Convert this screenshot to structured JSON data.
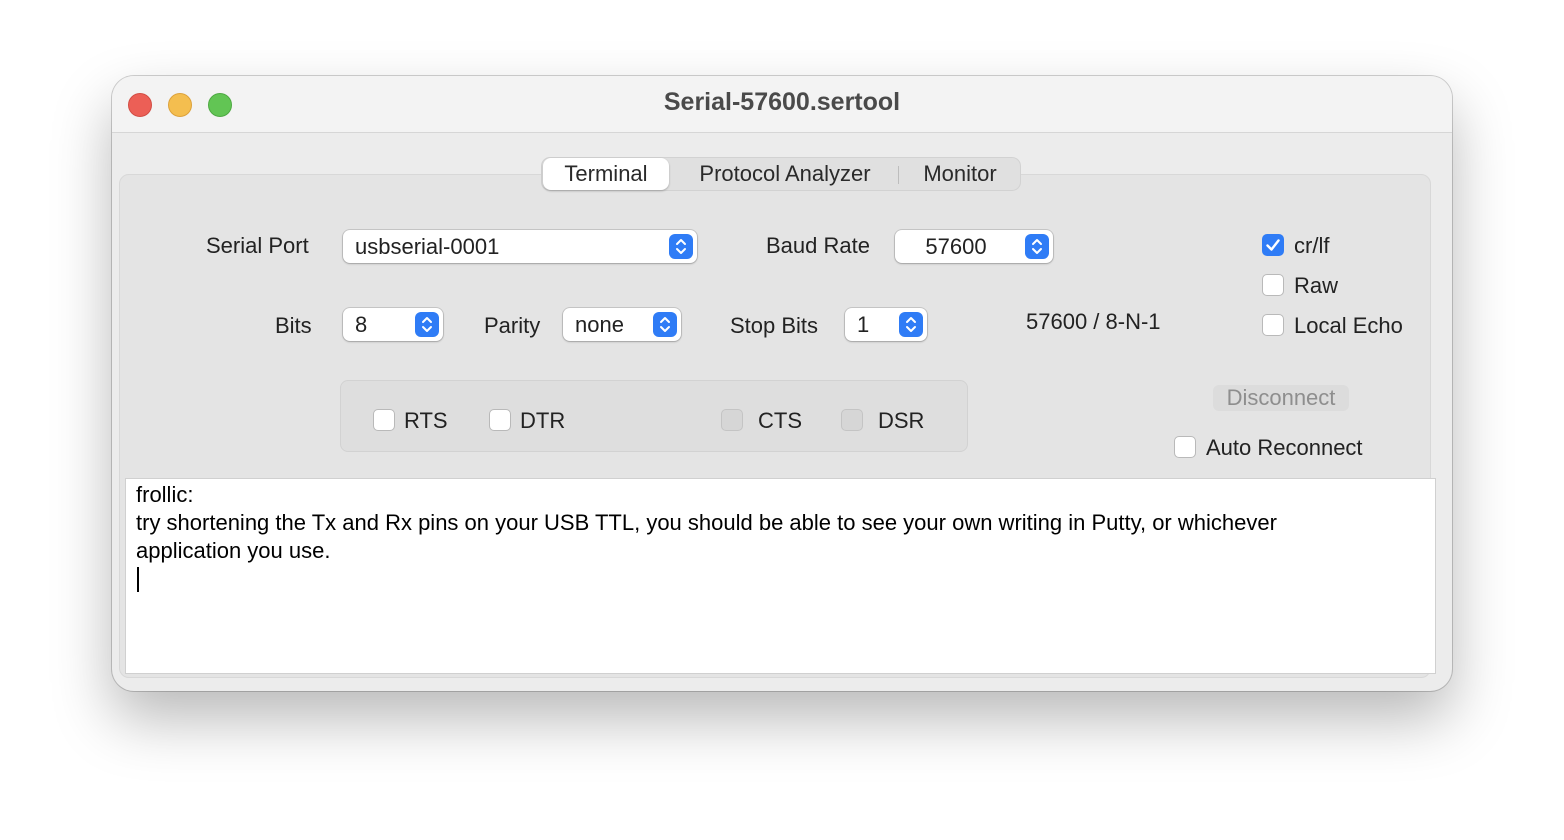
{
  "window": {
    "title": "Serial-57600.sertool"
  },
  "tabs": [
    {
      "label": "Terminal",
      "active": true
    },
    {
      "label": "Protocol Analyzer",
      "active": false
    },
    {
      "label": "Monitor",
      "active": false
    }
  ],
  "settings": {
    "serial_port": {
      "label": "Serial Port",
      "value": "usbserial-0001"
    },
    "baud_rate": {
      "label": "Baud Rate",
      "value": "57600"
    },
    "bits": {
      "label": "Bits",
      "value": "8"
    },
    "parity": {
      "label": "Parity",
      "value": "none"
    },
    "stop_bits": {
      "label": "Stop Bits",
      "value": "1"
    },
    "summary": "57600 / 8-N-1"
  },
  "options": {
    "crlf": {
      "label": "cr/lf",
      "checked": true
    },
    "raw": {
      "label": "Raw",
      "checked": false
    },
    "local_echo": {
      "label": "Local Echo",
      "checked": false
    },
    "auto_reconnect": {
      "label": "Auto Reconnect",
      "checked": false
    }
  },
  "signals": {
    "rts": {
      "label": "RTS",
      "checked": false
    },
    "dtr": {
      "label": "DTR",
      "checked": false
    },
    "cts": {
      "label": "CTS",
      "enabled": false
    },
    "dsr": {
      "label": "DSR",
      "enabled": false
    }
  },
  "actions": {
    "disconnect_label": "Disconnect"
  },
  "terminal": {
    "lines": [
      "frollic:",
      "try shortening the Tx and Rx pins on your USB TTL, you should be able to see your own writing in Putty, or whichever",
      "application you use."
    ]
  },
  "colors": {
    "accent": "#2f7cf6",
    "close": "#ec5f56",
    "minimize": "#f4be4f",
    "zoom": "#62c554"
  }
}
